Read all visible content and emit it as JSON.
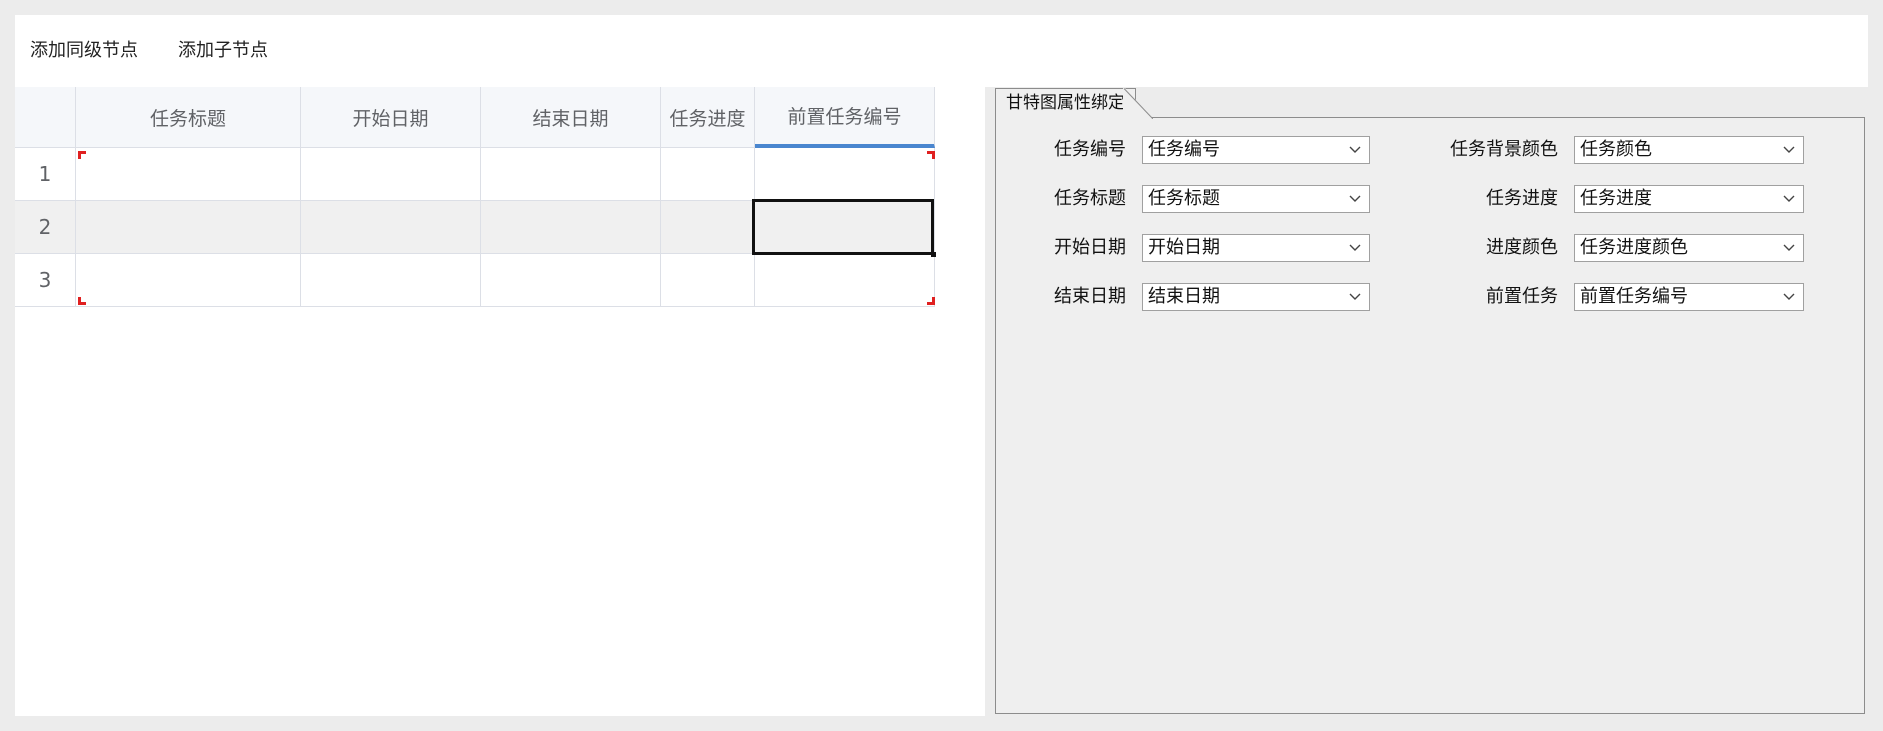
{
  "toolbar": {
    "add_sibling": "添加同级节点",
    "add_child": "添加子节点"
  },
  "grid": {
    "columns": [
      "任务标题",
      "开始日期",
      "结束日期",
      "任务进度",
      "前置任务编号"
    ],
    "rows": [
      "1",
      "2",
      "3"
    ],
    "selected_column": "前置任务编号"
  },
  "panel": {
    "tab_title": "甘特图属性绑定",
    "fields": {
      "task_id_label": "任务编号",
      "task_id_value": "任务编号",
      "task_title_label": "任务标题",
      "task_title_value": "任务标题",
      "start_date_label": "开始日期",
      "start_date_value": "开始日期",
      "end_date_label": "结束日期",
      "end_date_value": "结束日期",
      "bg_color_label": "任务背景颜色",
      "bg_color_value": "任务颜色",
      "progress_label": "任务进度",
      "progress_value": "任务进度",
      "progress_color_label": "进度颜色",
      "progress_color_value": "任务进度颜色",
      "predecessor_label": "前置任务",
      "predecessor_value": "前置任务编号"
    }
  },
  "colors": {
    "selected_column_accent": "#4a86cf",
    "corner_marker": "#e02020"
  },
  "icons": [
    "chevron-down-icon"
  ]
}
